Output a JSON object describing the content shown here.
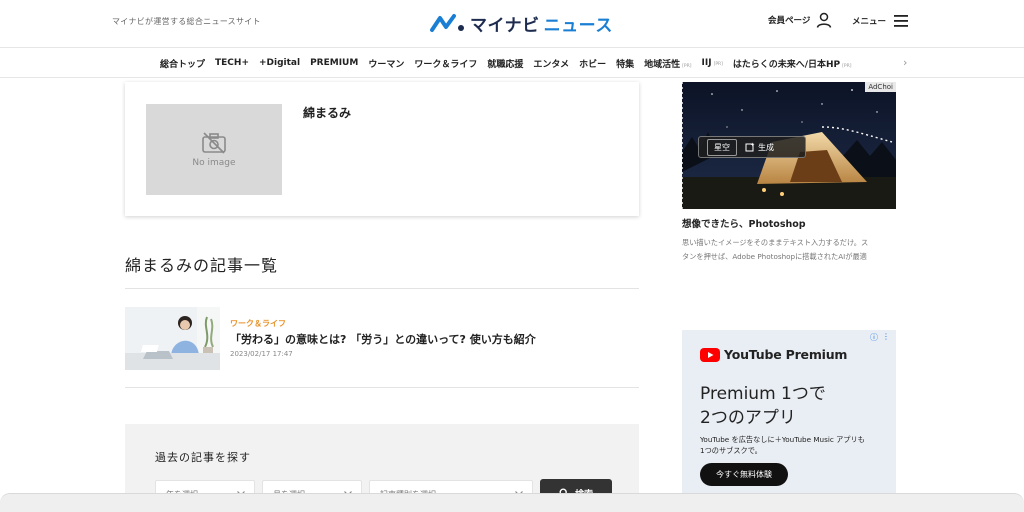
{
  "header": {
    "tagline": "マイナビが運営する総合ニュースサイト",
    "logo_main": "マイナビ",
    "logo_sub": "ニュース",
    "member_label": "会員ページ",
    "menu_label": "メニュー"
  },
  "nav": {
    "items": [
      {
        "label": "総合トップ",
        "pr": ""
      },
      {
        "label": "TECH+",
        "pr": ""
      },
      {
        "label": "+Digital",
        "pr": ""
      },
      {
        "label": "PREMIUM",
        "pr": ""
      },
      {
        "label": "ウーマン",
        "pr": ""
      },
      {
        "label": "ワーク＆ライフ",
        "pr": ""
      },
      {
        "label": "就職応援",
        "pr": ""
      },
      {
        "label": "エンタメ",
        "pr": ""
      },
      {
        "label": "ホビー",
        "pr": ""
      },
      {
        "label": "特集",
        "pr": ""
      },
      {
        "label": "地域活性",
        "pr": "[PR]"
      },
      {
        "label": "IIJ",
        "pr": "[PR]"
      },
      {
        "label": "はたらくの未来へ/日本HP",
        "pr": "[PR]"
      }
    ]
  },
  "author": {
    "name": "綿まるみ",
    "no_image_label": "No image"
  },
  "article_list": {
    "title": "綿まるみの記事一覧",
    "articles": [
      {
        "category": "ワーク＆ライフ",
        "title": "「労わる」の意味とは? 「労う」との違いって? 使い方も紹介",
        "date": "2023/02/17 17:47"
      }
    ]
  },
  "archive": {
    "title": "過去の記事を探す",
    "year_placeholder": "年を選択",
    "month_placeholder": "月を選択",
    "type_placeholder": "記事種別を選択",
    "search_label": "検索"
  },
  "ad1": {
    "adchoices": "AdChoi",
    "field_text": "星空",
    "generate_label": "生成",
    "title": "想像できたら、Photoshop",
    "desc_line1": "思い描いたイメージをそのままテキスト入力するだけ。ス",
    "desc_line2": "タンを押せば、Adobe Photoshopに搭載されたAIが最適"
  },
  "ad2": {
    "brand": "YouTube Premium",
    "headline_line1": "Premium 1つで",
    "headline_line2": "2つのアプリ",
    "desc_line1": "YouTube を広告なしに＋YouTube Music アプリも",
    "desc_line2": "1つのサブスクで。",
    "cta": "今すぐ無料体験"
  },
  "colors": {
    "logo_navy": "#1d2b4f",
    "logo_blue": "#1a7fd4",
    "category_orange": "#e8922a",
    "youtube_red": "#ff0000"
  }
}
